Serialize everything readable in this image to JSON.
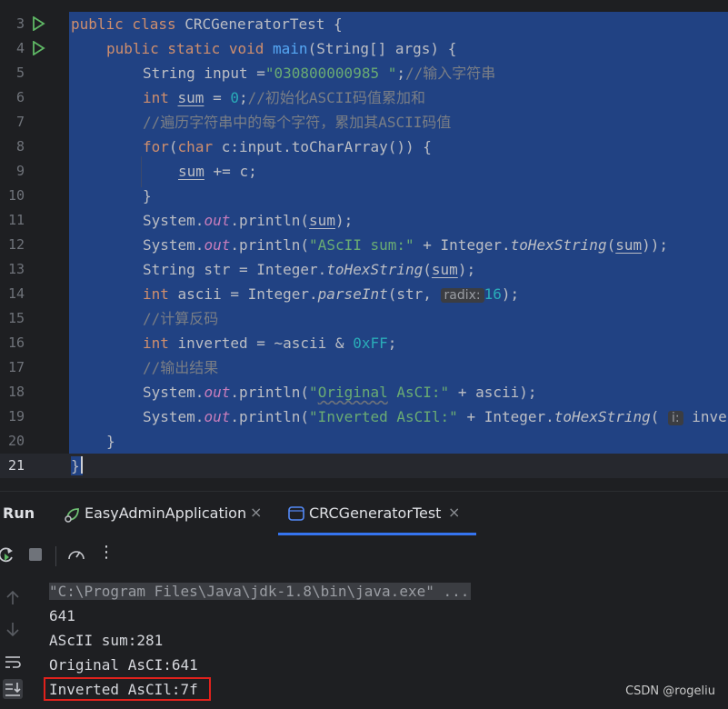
{
  "editor": {
    "lines": [
      {
        "n": "3",
        "run": true
      },
      {
        "n": "4",
        "run": true
      },
      {
        "n": "5"
      },
      {
        "n": "6"
      },
      {
        "n": "7"
      },
      {
        "n": "8"
      },
      {
        "n": "9"
      },
      {
        "n": "10"
      },
      {
        "n": "11"
      },
      {
        "n": "12"
      },
      {
        "n": "13"
      },
      {
        "n": "14"
      },
      {
        "n": "15"
      },
      {
        "n": "16"
      },
      {
        "n": "17"
      },
      {
        "n": "18"
      },
      {
        "n": "19"
      },
      {
        "n": "20"
      },
      {
        "n": "21"
      }
    ],
    "code": {
      "l3_kw": "public class ",
      "l3_name": "CRCGeneratorTest {",
      "l4_kw": "public static void ",
      "l4_fn": "main",
      "l4_rest": "(String[] args) {",
      "l5_a": "String input =",
      "l5_str": "\"030800000985 \"",
      "l5_semi": ";",
      "l5_cm": "//输入字符串",
      "l6_kw": "int ",
      "l6_var": "sum",
      "l6_eq": " = ",
      "l6_num": "0",
      "l6_semi": ";",
      "l6_cm": "//初始化ASCII码值累加和",
      "l7_cm": "//遍历字符串中的每个字符，累加其ASCII码值",
      "l8_kw": "for",
      "l8_p": "(",
      "l8_kw2": "char",
      "l8_rest": " c:input.toCharArray()) {",
      "l9_var": "sum",
      "l9_rest": " += c;",
      "l10": "}",
      "l11_a": "System.",
      "l11_out": "out",
      "l11_b": ".println(",
      "l11_var": "sum",
      "l11_c": ");",
      "l12_a": "System.",
      "l12_out": "out",
      "l12_b": ".println(",
      "l12_str": "\"AScII sum:\"",
      "l12_c": " + Integer.",
      "l12_m": "toHexString",
      "l12_d": "(",
      "l12_var": "sum",
      "l12_e": "));",
      "l13_a": "String str = Integer.",
      "l13_m": "toHexString",
      "l13_b": "(",
      "l13_var": "sum",
      "l13_c": ");",
      "l14_kw": "int ",
      "l14_a": "ascii = Integer.",
      "l14_m": "parseInt",
      "l14_b": "(str, ",
      "l14_hint": "radix:",
      "l14_num": "16",
      "l14_c": ");",
      "l15_cm": "//计算反码",
      "l16_kw": "int ",
      "l16_a": "inverted = ~ascii & ",
      "l16_num": "0xFF",
      "l16_b": ";",
      "l17_cm": "//输出结果",
      "l18_a": "System.",
      "l18_out": "out",
      "l18_b": ".println(",
      "l18_str1": "\"",
      "l18_str2": "Original",
      "l18_str3": " AsCI:\"",
      "l18_c": " + ascii);",
      "l19_a": "System.",
      "l19_out": "out",
      "l19_b": ".println(",
      "l19_str": "\"Inverted AsCIl:\"",
      "l19_c": " + Integer.",
      "l19_m": "toHexString",
      "l19_d": "( ",
      "l19_hint": "i:",
      "l19_e": " inve",
      "l20": "}",
      "l21": "}"
    }
  },
  "run": {
    "title": "Run",
    "tabs": [
      {
        "label": "EasyAdminApplication",
        "close": "×"
      },
      {
        "label": "CRCGeneratorTest",
        "close": "×"
      }
    ],
    "toolbar": {
      "more": "⋮"
    },
    "console": [
      "\"C:\\Program Files\\Java\\jdk-1.8\\bin\\java.exe\" ...",
      "641",
      "AScII sum:281",
      "Original AsCI:641",
      "Inverted AsCIl:7f"
    ]
  },
  "watermark": "CSDN @rogeliu",
  "colors": {
    "selection": "#214283",
    "highlight_box": "#e0211c",
    "active_tab": "#3574f0"
  }
}
